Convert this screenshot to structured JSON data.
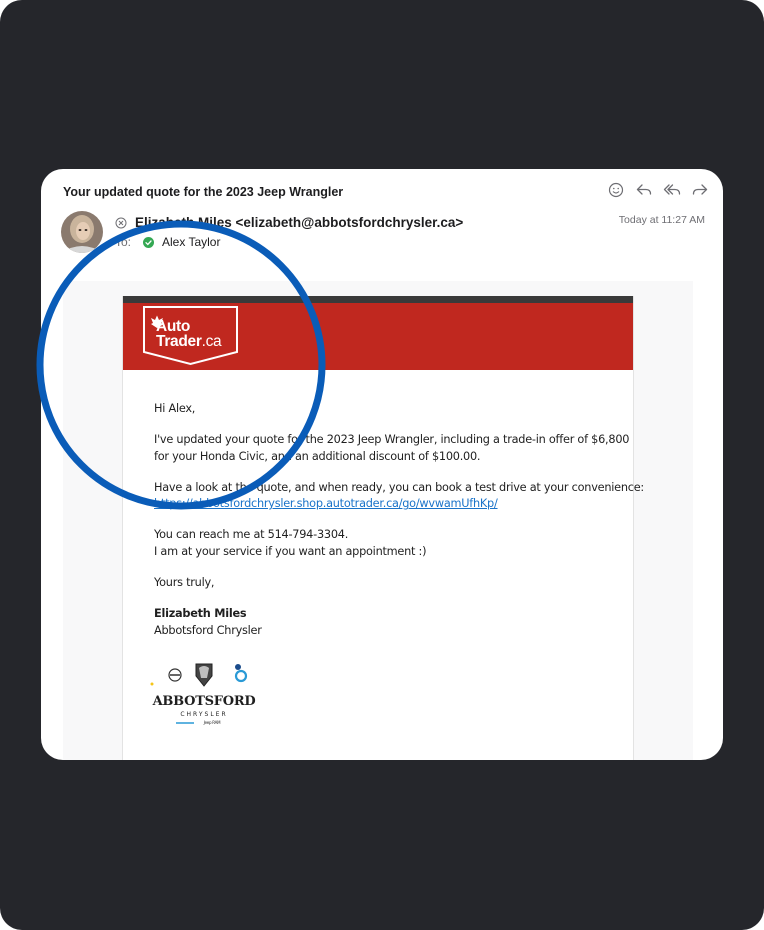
{
  "email": {
    "subject": "Your updated quote for the 2023 Jeep Wrangler",
    "from": "Elizabeth Miles <elizabeth@abbotsfordchrysler.ca>",
    "to_label": "To:",
    "to_name": "Alex Taylor",
    "timestamp": "Today at 11:27 AM"
  },
  "toolbar": {
    "icons": [
      "smiley-icon",
      "reply-icon",
      "reply-all-icon",
      "forward-icon"
    ]
  },
  "letter": {
    "logo_line1": "Auto",
    "logo_line2a": "Trader",
    "logo_line2b": ".ca",
    "greeting": "Hi Alex,",
    "para1_line1": "I've updated your quote for the 2023 Jeep Wrangler, including a trade-in offer of $6,800",
    "para1_line2": "for your Honda Civic, and an additional discount of $100.00.",
    "para2_line1": "Have a look at the quote, and when ready, you can book a test drive at your convenience:",
    "link": "https://abbotsfordchrysler.shop.autotrader.ca/go/wvwamUfhKp/",
    "para3_line1": "You can reach me at 514-794-3304.",
    "para3_line2": "I am at your service if you want an appointment :)",
    "closing": "Yours truly,",
    "sig_name": "Elizabeth Miles",
    "sig_company": "Abbotsford Chrysler",
    "dealer_name": "ABBOTSFORD",
    "dealer_sub": "CHRYSLER",
    "dealer_brands": "Jeep RAM"
  },
  "colors": {
    "frame_bg": "#25262b",
    "banner_red": "#c0281f",
    "highlight_circle": "#0a5cb8",
    "link_blue": "#1a73c9",
    "check_green": "#34a853"
  }
}
